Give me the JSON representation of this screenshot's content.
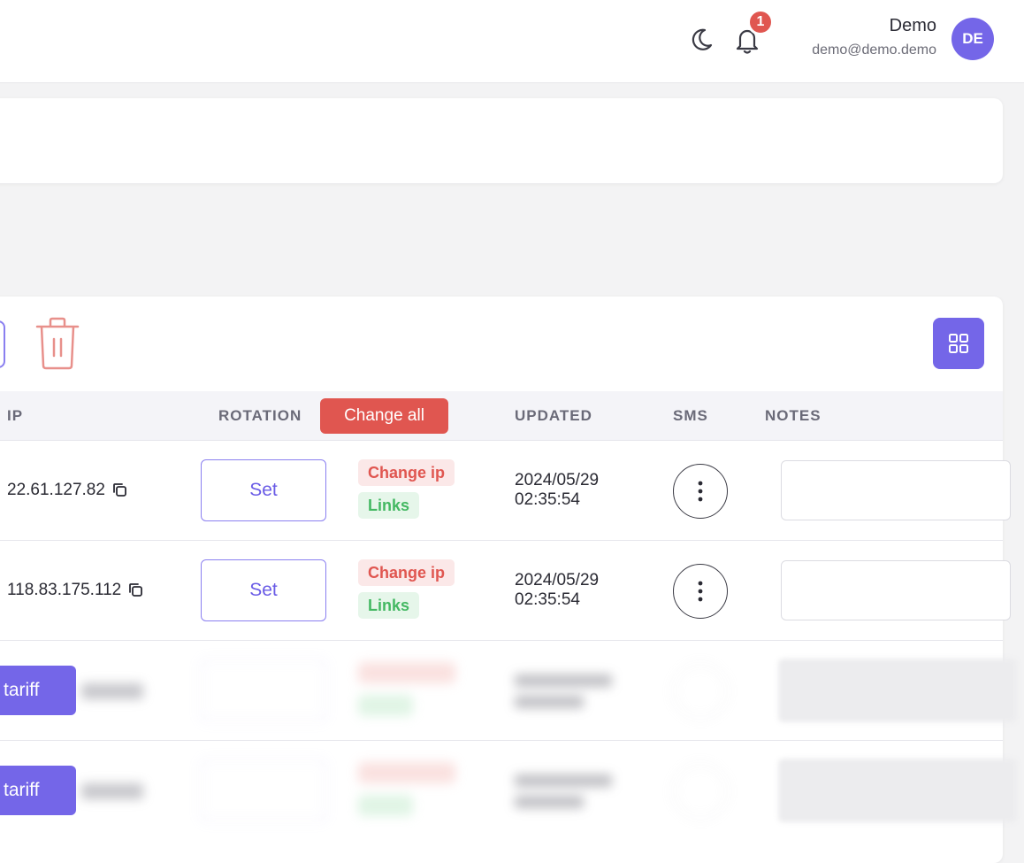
{
  "header": {
    "notifications_count": "1",
    "user_name": "Demo",
    "user_email": "demo@demo.demo",
    "avatar_initials": "DE",
    "icons": [
      "moon-icon",
      "bell-icon"
    ]
  },
  "table": {
    "columns": {
      "ip": "IP",
      "rotation": "ROTATION",
      "updated": "UPDATED",
      "sms": "SMS",
      "notes": "NOTES"
    },
    "change_all_label": "Change all",
    "rows": [
      {
        "ip": "22.61.127.82",
        "set_label": "Set",
        "change_ip_label": "Change ip",
        "links_label": "Links",
        "updated_date": "2024/05/29",
        "updated_time": "02:35:54",
        "note": ""
      },
      {
        "ip": "118.83.175.112",
        "set_label": "Set",
        "change_ip_label": "Change ip",
        "links_label": "Links",
        "updated_date": "2024/05/29",
        "updated_time": "02:35:54",
        "note": ""
      }
    ],
    "locked_rows": [
      {
        "tariff_label": "tariff"
      },
      {
        "tariff_label": "tariff"
      }
    ]
  },
  "colors": {
    "accent": "#7466e8",
    "danger": "#e05650",
    "success": "#43b862"
  }
}
